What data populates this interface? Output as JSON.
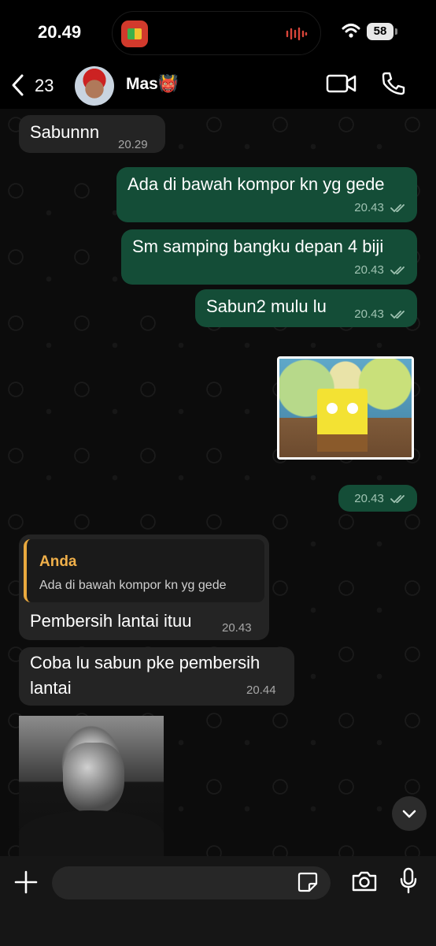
{
  "status_bar": {
    "time": "20.49",
    "battery": "58"
  },
  "header": {
    "back_count": "23",
    "contact_name": "Mas👹"
  },
  "messages": [
    {
      "text": "Sabunnn",
      "time": "20.29"
    },
    {
      "text": "Ada di bawah kompor kn yg gede",
      "time": "20.43"
    },
    {
      "text": "Sm samping bangku depan 4 biji",
      "time": "20.43"
    },
    {
      "text": "Sabun2 mulu lu",
      "time": "20.43"
    },
    {
      "time": "20.43"
    },
    {
      "reply_author": "Anda",
      "reply_text": "Ada di bawah kompor kn yg gede",
      "text": "Pembersih lantai ituu",
      "time": "20.43"
    },
    {
      "text": "Coba lu sabun pke pembersih lantai",
      "time": "20.44"
    }
  ],
  "input": {
    "placeholder": ""
  },
  "colors": {
    "outgoing_bubble": "#144d37",
    "incoming_bubble": "#242424",
    "reply_accent": "#f0b04a"
  },
  "icons": [
    "back-chevron-icon",
    "video-call-icon",
    "phone-call-icon",
    "double-check-icon",
    "chevron-down-icon",
    "plus-icon",
    "sticker-icon",
    "camera-icon",
    "microphone-icon"
  ]
}
